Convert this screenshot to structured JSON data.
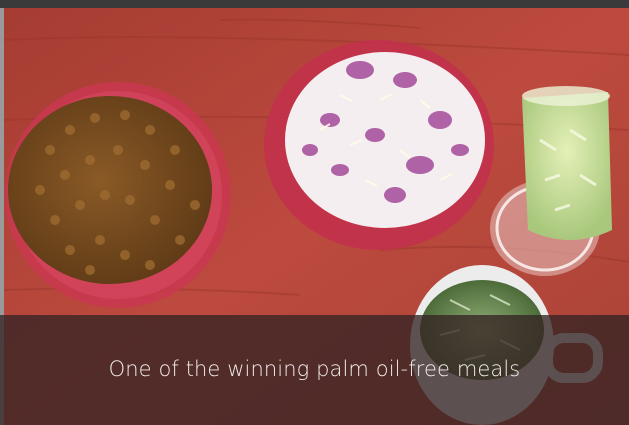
{
  "caption": {
    "text": "One of the winning palm oil-free meals"
  },
  "photo": {
    "subjects": [
      "baked-beans-plate",
      "mashed-potato-cheese-onion-plate",
      "cucumber-salad-glass",
      "greens-soup-mug"
    ],
    "table_color": "#b5453a",
    "plate_color": "#c8334f",
    "overlay_color": "#342424"
  }
}
